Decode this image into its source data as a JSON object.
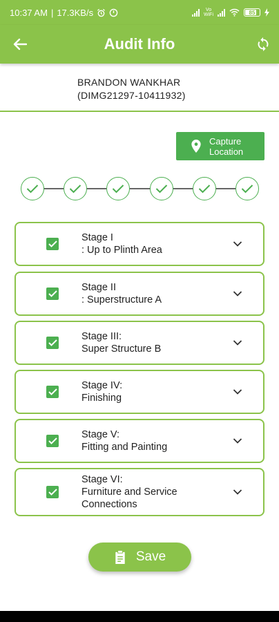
{
  "status_bar": {
    "time": "10:37 AM",
    "speed": "17.3KB/s",
    "volte": "Vo\nWiFi",
    "battery": "85"
  },
  "app_bar": {
    "title": "Audit Info",
    "icons": {
      "back": "arrow-left-icon",
      "sync": "sync-icon"
    }
  },
  "person": {
    "name": "BRANDON WANKHAR",
    "id": "(DIMG21297-10411932)"
  },
  "capture": {
    "label_line1": "Capture",
    "label_line2": "Location",
    "icon": "location-pin-icon"
  },
  "stepper": {
    "step_count": 6,
    "completed": 6
  },
  "stages": [
    {
      "line1": "Stage I",
      "line2": ": Up to Plinth Area",
      "line3": "",
      "checked": true
    },
    {
      "line1": "Stage II",
      "line2": ": Superstructure A",
      "line3": "",
      "checked": true
    },
    {
      "line1": "Stage III:",
      "line2": "Super Structure B",
      "line3": "",
      "checked": true
    },
    {
      "line1": "Stage IV:",
      "line2": "Finishing",
      "line3": "",
      "checked": true
    },
    {
      "line1": "Stage V:",
      "line2": "Fitting and Painting",
      "line3": "",
      "checked": true
    },
    {
      "line1": "Stage VI:",
      "line2": "Furniture and Service",
      "line3": "Connections",
      "checked": true
    }
  ],
  "save": {
    "label": "Save",
    "icon": "clipboard-icon"
  },
  "colors": {
    "primary": "#8bc34a",
    "accent": "#4caf50"
  }
}
